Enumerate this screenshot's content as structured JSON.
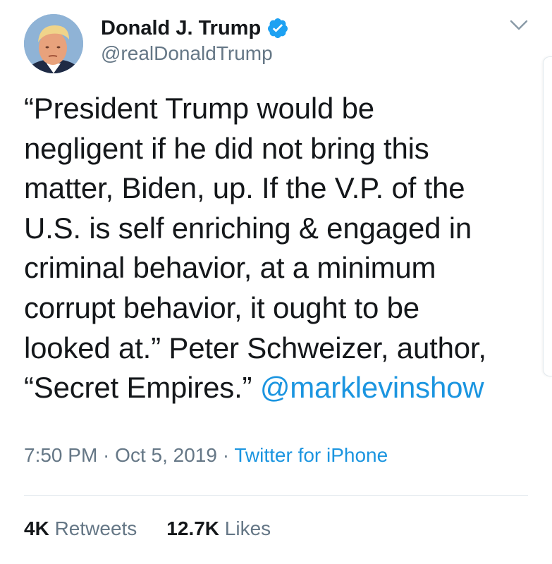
{
  "author": {
    "display_name": "Donald J. Trump",
    "handle": "@realDonaldTrump",
    "verified": true
  },
  "tweet": {
    "lines": [
      "“President Trump would be",
      "negligent if he did not bring this",
      "matter, Biden, up. If the V.P. of the",
      "U.S. is self enriching & engaged in",
      "criminal behavior, at a minimum",
      "corrupt behavior, it ought to be",
      "looked at.” Peter Schweizer, author,"
    ],
    "last_line_text": "“Secret Empires.” ",
    "mention": "@marklevinshow"
  },
  "meta": {
    "time": "7:50 PM",
    "separator": " · ",
    "date": "Oct 5, 2019",
    "separator2": " · ",
    "source": "Twitter for iPhone"
  },
  "stats": {
    "retweets_count": "4K",
    "retweets_label": "Retweets",
    "likes_count": "12.7K",
    "likes_label": "Likes"
  },
  "colors": {
    "link": "#1b95e0",
    "secondary_text": "#657786",
    "primary_text": "#14171a"
  },
  "icons": {
    "verified": "verified-badge-icon",
    "menu": "chevron-down-icon"
  }
}
